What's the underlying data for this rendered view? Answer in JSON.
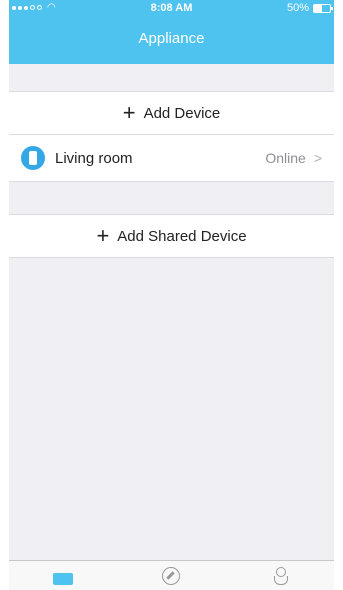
{
  "status_bar": {
    "time": "8:08 AM",
    "battery_percent": "50%",
    "wifi_icon": "wifi-icon"
  },
  "nav": {
    "title": "Appliance"
  },
  "actions": {
    "add_device_label": "Add Device",
    "add_shared_device_label": "Add Shared Device",
    "plus_icon": "plus-icon"
  },
  "devices": [
    {
      "name": "Living room",
      "status": "Online",
      "icon": "device-icon"
    }
  ],
  "tabs": [
    {
      "icon": "appliance-tab-icon",
      "active": true
    },
    {
      "icon": "compass-tab-icon",
      "active": false
    },
    {
      "icon": "user-tab-icon",
      "active": false
    }
  ],
  "colors": {
    "accent": "#4fc3f0",
    "background": "#efeff4",
    "device_icon": "#34a8e4"
  }
}
